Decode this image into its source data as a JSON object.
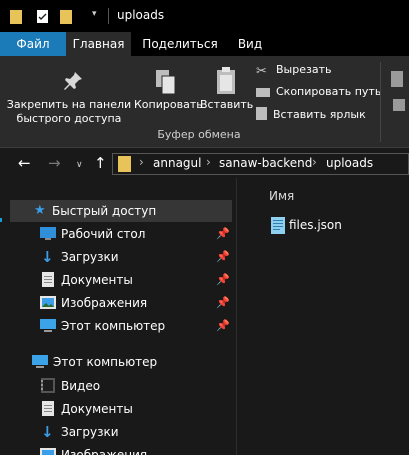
{
  "window": {
    "title": "uploads"
  },
  "tabs": {
    "file": "Файл",
    "home": "Главная",
    "share": "Поделиться",
    "view": "Вид"
  },
  "ribbon": {
    "pin_line1": "Закрепить на панели",
    "pin_line2": "быстрого доступа",
    "copy": "Копировать",
    "paste": "Вставить",
    "cut": "Вырезать",
    "copy_path": "Скопировать путь",
    "paste_shortcut": "Вставить ярлык",
    "group_clipboard": "Буфер обмена"
  },
  "address": {
    "crumbs": [
      "annagul",
      "sanaw-backend",
      "uploads"
    ]
  },
  "nav": {
    "quick_access": "Быстрый доступ",
    "pinned": [
      "Рабочий стол",
      "Загрузки",
      "Документы",
      "Изображения",
      "Этот компьютер"
    ],
    "this_pc": "Этот компьютер",
    "pc_items": [
      "Видео",
      "Документы",
      "Загрузки",
      "Изображения"
    ]
  },
  "content": {
    "column_name": "Имя",
    "files": [
      "files.json"
    ]
  },
  "colors": {
    "accent": "#1a7bb8",
    "folder": "#e8c35a"
  }
}
